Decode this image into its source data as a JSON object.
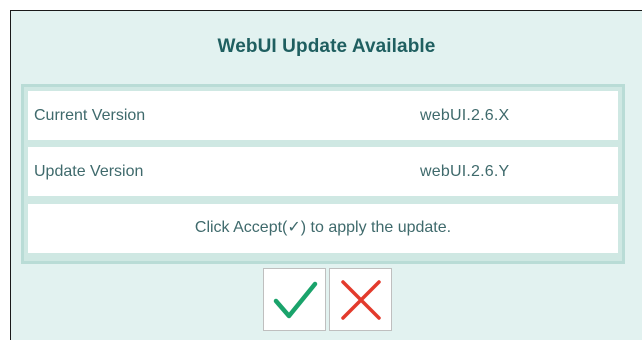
{
  "dialog": {
    "title": "WebUI Update Available",
    "rows": [
      {
        "label": "Current Version",
        "value": "webUI.2.6.X"
      },
      {
        "label": "Update Version",
        "value": "webUI.2.6.Y"
      }
    ],
    "message": "Click Accept(✓) to apply the update.",
    "accept_icon": "checkmark-icon",
    "reject_icon": "cross-icon"
  },
  "colors": {
    "title_text": "#1f5f60",
    "body_text": "#3f6a6c",
    "dialog_background": "#e2f2f0",
    "accept_green": "#1aa36b",
    "reject_red": "#e33a2c"
  }
}
